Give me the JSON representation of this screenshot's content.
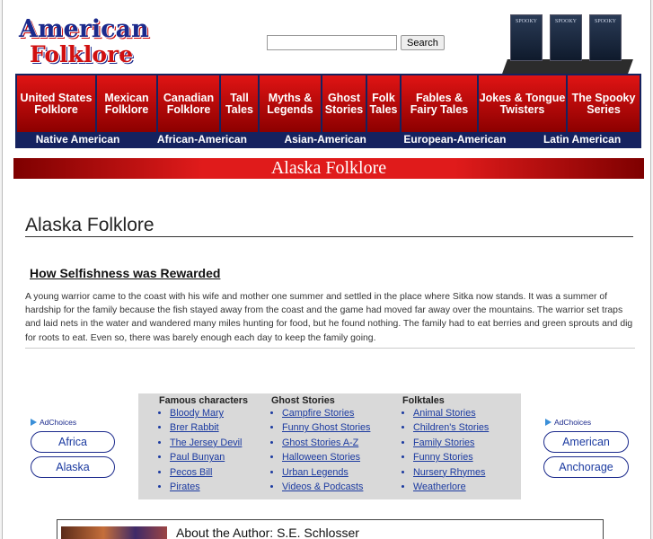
{
  "header": {
    "logo_line1": "American",
    "logo_line2": "Folklore",
    "search_placeholder": "",
    "search_button": "Search",
    "books": [
      "SPOOKY",
      "SPOOKY",
      "SPOOKY"
    ]
  },
  "nav": {
    "top": [
      "United States Folklore",
      "Mexican Folklore",
      "Canadian Folklore",
      "Tall Tales",
      "Myths & Legends",
      "Ghost Stories",
      "Folk Tales",
      "Fables & Fairy Tales",
      "Jokes & Tongue Twisters",
      "The Spooky Series"
    ],
    "bottom": [
      "Native American",
      "African-American",
      "Asian-American",
      "European-American",
      "Latin American"
    ]
  },
  "banner": "Alaska Folklore",
  "page_title": "Alaska Folklore",
  "story": {
    "title": "How Selfishness was Rewarded",
    "text": "A young warrior came to the coast with his wife and mother one summer and settled in the place where Sitka now stands. It was a summer of hardship for the family because the fish stayed away from the coast and the game had moved far away over the mountains. The warrior set traps and laid nets in the water and wandered many miles hunting for food, but he found nothing. The family had to eat berries and green sprouts and dig for roots to eat. Even so, there was barely enough each day to keep the family going."
  },
  "ads_left": {
    "label": "AdChoices",
    "buttons": [
      "Africa",
      "Alaska"
    ]
  },
  "ads_right": {
    "label": "AdChoices",
    "buttons": [
      "American",
      "Anchorage"
    ]
  },
  "links": [
    {
      "heading": "Famous characters",
      "items": [
        "Bloody Mary",
        "Brer Rabbit",
        "The Jersey Devil",
        "Paul Bunyan",
        "Pecos Bill",
        "Pirates"
      ]
    },
    {
      "heading": "Ghost Stories",
      "items": [
        "Campfire Stories",
        "Funny Ghost Stories",
        "Ghost Stories A-Z",
        "Halloween Stories",
        "Urban Legends",
        "Videos & Podcasts"
      ]
    },
    {
      "heading": "Folktales",
      "items": [
        "Animal Stories",
        "Children's Stories",
        "Family Stories",
        "Funny Stories",
        "Nursery Rhymes",
        "Weatherlore"
      ]
    }
  ],
  "author": {
    "title": "About the Author: S.E. Schlosser"
  },
  "colors": {
    "nav_red": "#c80000",
    "nav_blue": "#15225f",
    "link": "#1b3aa0"
  }
}
